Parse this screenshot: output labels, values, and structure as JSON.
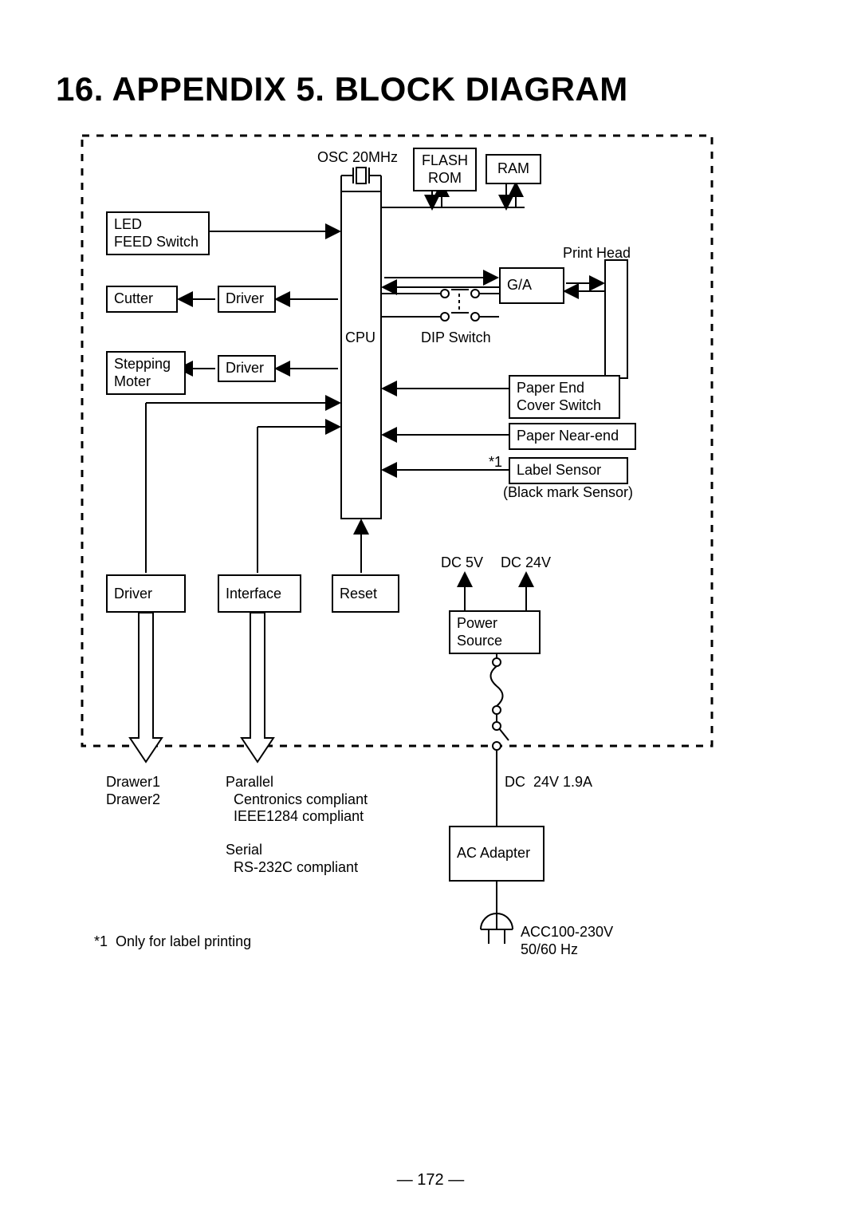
{
  "page": {
    "title": "16. APPENDIX 5. BLOCK DIAGRAM",
    "footer": "— 172 —"
  },
  "blocks": {
    "osc": "OSC 20MHz",
    "flash": "FLASH\nROM",
    "ram": "RAM",
    "led": "LED\nFEED Switch",
    "cutter": "Cutter",
    "driver1": "Driver",
    "stepping": "Stepping\nMoter",
    "driver2": "Driver",
    "cpu": "CPU",
    "ga": "G/A",
    "dip": "DIP Switch",
    "print_head": "Print Head",
    "paper_end": "Paper End\nCover Switch",
    "paper_near": "Paper Near-end",
    "star1": "*1",
    "label_sensor": "Label Sensor",
    "black_mark": "(Black mark Sensor)",
    "driver3": "Driver",
    "interface": "Interface",
    "reset": "Reset",
    "power": "Power\nSource",
    "dc5": "DC 5V",
    "dc24": "DC 24V",
    "drawer": "Drawer1\nDrawer2",
    "parallel": "Parallel\n  Centronics compliant\n  IEEE1284 compliant",
    "serial": "Serial\n  RS-232C compliant",
    "dc24a": "DC  24V 1.9A",
    "ac": "AC Adapter",
    "acc": "ACC100-230V\n50/60 Hz",
    "footnote": "*1  Only for label printing"
  }
}
